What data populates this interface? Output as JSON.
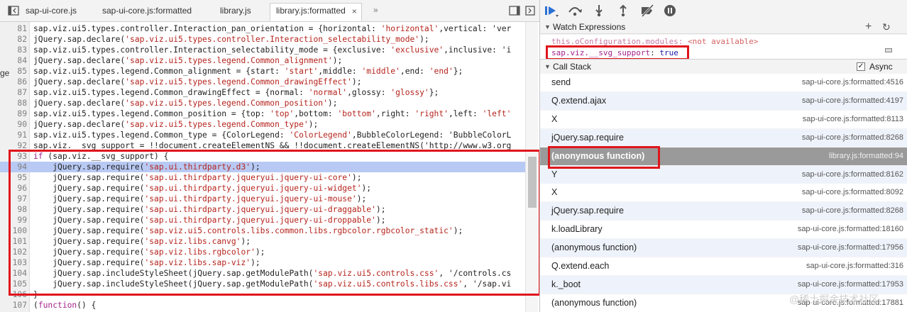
{
  "tabs": [
    {
      "label": "sap-ui-core.js",
      "active": false
    },
    {
      "label": "sap-ui-core.js:formatted",
      "active": false
    },
    {
      "label": "library.js",
      "active": false
    },
    {
      "label": "library.js:formatted",
      "active": true
    }
  ],
  "tab_close_glyph": "×",
  "tab_overflow_glyph": "»",
  "left_edge_fragment": "ge",
  "code_lines": [
    {
      "n": "81",
      "src": "sap.viz.ui5.types.controller.Interaction_pan_orientation = {horizontal: 'horizontal',vertical: 'ver"
    },
    {
      "n": "82",
      "src": "jQuery.sap.declare('sap.viz.ui5.types.controller.Interaction_selectability_mode');"
    },
    {
      "n": "83",
      "src": "sap.viz.ui5.types.controller.Interaction_selectability_mode = {exclusive: 'exclusive',inclusive: 'i"
    },
    {
      "n": "84",
      "src": "jQuery.sap.declare('sap.viz.ui5.types.legend.Common_alignment');"
    },
    {
      "n": "85",
      "src": "sap.viz.ui5.types.legend.Common_alignment = {start: 'start',middle: 'middle',end: 'end'};"
    },
    {
      "n": "86",
      "src": "jQuery.sap.declare('sap.viz.ui5.types.legend.Common_drawingEffect');"
    },
    {
      "n": "87",
      "src": "sap.viz.ui5.types.legend.Common_drawingEffect = {normal: 'normal',glossy: 'glossy'};"
    },
    {
      "n": "88",
      "src": "jQuery.sap.declare('sap.viz.ui5.types.legend.Common_position');"
    },
    {
      "n": "89",
      "src": "sap.viz.ui5.types.legend.Common_position = {top: 'top',bottom: 'bottom',right: 'right',left: 'left'"
    },
    {
      "n": "90",
      "src": "jQuery.sap.declare('sap.viz.ui5.types.legend.Common_type');"
    },
    {
      "n": "91",
      "src": "sap.viz.ui5.types.legend.Common_type = {ColorLegend: 'ColorLegend',BubbleColorLegend: 'BubbleColorL"
    },
    {
      "n": "92",
      "src": "sap.viz.__svg_support = !!document.createElementNS && !!document.createElementNS('http://www.w3.org"
    },
    {
      "n": "93",
      "src": "if (sap.viz.__svg_support) {"
    },
    {
      "n": "94",
      "src": "    jQuery.sap.require('sap.ui.thirdparty.d3');",
      "exec": true
    },
    {
      "n": "95",
      "src": "    jQuery.sap.require('sap.ui.thirdparty.jqueryui.jquery-ui-core');"
    },
    {
      "n": "96",
      "src": "    jQuery.sap.require('sap.ui.thirdparty.jqueryui.jquery-ui-widget');"
    },
    {
      "n": "97",
      "src": "    jQuery.sap.require('sap.ui.thirdparty.jqueryui.jquery-ui-mouse');"
    },
    {
      "n": "98",
      "src": "    jQuery.sap.require('sap.ui.thirdparty.jqueryui.jquery-ui-draggable');"
    },
    {
      "n": "99",
      "src": "    jQuery.sap.require('sap.ui.thirdparty.jqueryui.jquery-ui-droppable');"
    },
    {
      "n": "100",
      "src": "    jQuery.sap.require('sap.viz.ui5.controls.libs.common.libs.rgbcolor.rgbcolor_static');"
    },
    {
      "n": "101",
      "src": "    jQuery.sap.require('sap.viz.libs.canvg');"
    },
    {
      "n": "102",
      "src": "    jQuery.sap.require('sap.viz.libs.rgbcolor');"
    },
    {
      "n": "103",
      "src": "    jQuery.sap.require('sap.viz.libs.sap-viz');"
    },
    {
      "n": "104",
      "src": "    jQuery.sap.includeStyleSheet(jQuery.sap.getModulePath('sap.viz.ui5.controls.css', '/controls.cs"
    },
    {
      "n": "105",
      "src": "    jQuery.sap.includeStyleSheet(jQuery.sap.getModulePath('sap.viz.ui5.controls.libs.css', '/sap.vi"
    },
    {
      "n": "106",
      "src": "}"
    },
    {
      "n": "107",
      "src": "(function() {"
    }
  ],
  "watch": {
    "header": "Watch Expressions",
    "add_glyph": "+",
    "refresh_glyph": "↻",
    "faded_row": {
      "name": "this.oConfiguration.modules",
      "value": "<not available>"
    },
    "row": {
      "name": "sap.viz.__svg_support",
      "value": "true"
    }
  },
  "call_stack": {
    "header": "Call Stack",
    "async_label": "Async",
    "async_checked": true,
    "frames": [
      {
        "name": "send",
        "location": "sap-ui-core.js:formatted:4516"
      },
      {
        "name": "Q.extend.ajax",
        "location": "sap-ui-core.js:formatted:4197"
      },
      {
        "name": "X",
        "location": "sap-ui-core.js:formatted:8113"
      },
      {
        "name": "jQuery.sap.require",
        "location": "sap-ui-core.js:formatted:8268"
      },
      {
        "name": "(anonymous function)",
        "location": "library.js:formatted:94",
        "selected": true
      },
      {
        "name": "Y",
        "location": "sap-ui-core.js:formatted:8162"
      },
      {
        "name": "X",
        "location": "sap-ui-core.js:formatted:8092"
      },
      {
        "name": "jQuery.sap.require",
        "location": "sap-ui-core.js:formatted:8268"
      },
      {
        "name": "k.loadLibrary",
        "location": "sap-ui-core.js:formatted:18160"
      },
      {
        "name": "(anonymous function)",
        "location": "sap-ui-core.js:formatted:17956"
      },
      {
        "name": "Q.extend.each",
        "location": "sap-ui-core.js:formatted:316"
      },
      {
        "name": "k._boot",
        "location": "sap-ui-core.js:formatted:17953"
      },
      {
        "name": "(anonymous function)",
        "location": "sap-ui-core.js:formatted:17881"
      }
    ]
  },
  "watermark": "@稀土掘金技术社区",
  "colors": {
    "highlight_box": "#e0151c",
    "exec_line": "#b8c9f3",
    "string": "#b5241d",
    "keyword": "#a3218e"
  }
}
